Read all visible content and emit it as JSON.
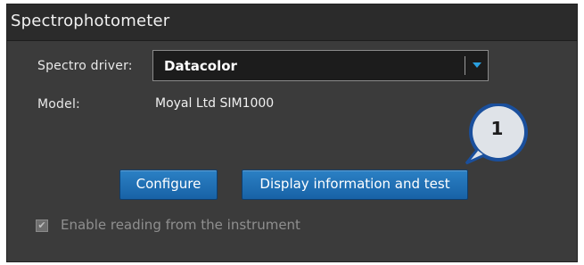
{
  "window": {
    "title": "Spectrophotometer"
  },
  "driver": {
    "label": "Spectro driver:",
    "value": "Datacolor"
  },
  "model": {
    "label": "Model:",
    "value": "Moyal Ltd SIM1000"
  },
  "buttons": {
    "configure": "Configure",
    "display": "Display information and test"
  },
  "enable_reading": {
    "label": "Enable reading from the instrument",
    "checked": true,
    "disabled": true
  },
  "callout": {
    "number": "1"
  },
  "colors": {
    "panel": "#3b3b3b",
    "titlebar": "#2b2b2b",
    "button": "#1f6fb6",
    "callout_fill": "#dfe3e8",
    "callout_border": "#1a4f9c",
    "dropdown_arrow": "#2aa0e0"
  }
}
